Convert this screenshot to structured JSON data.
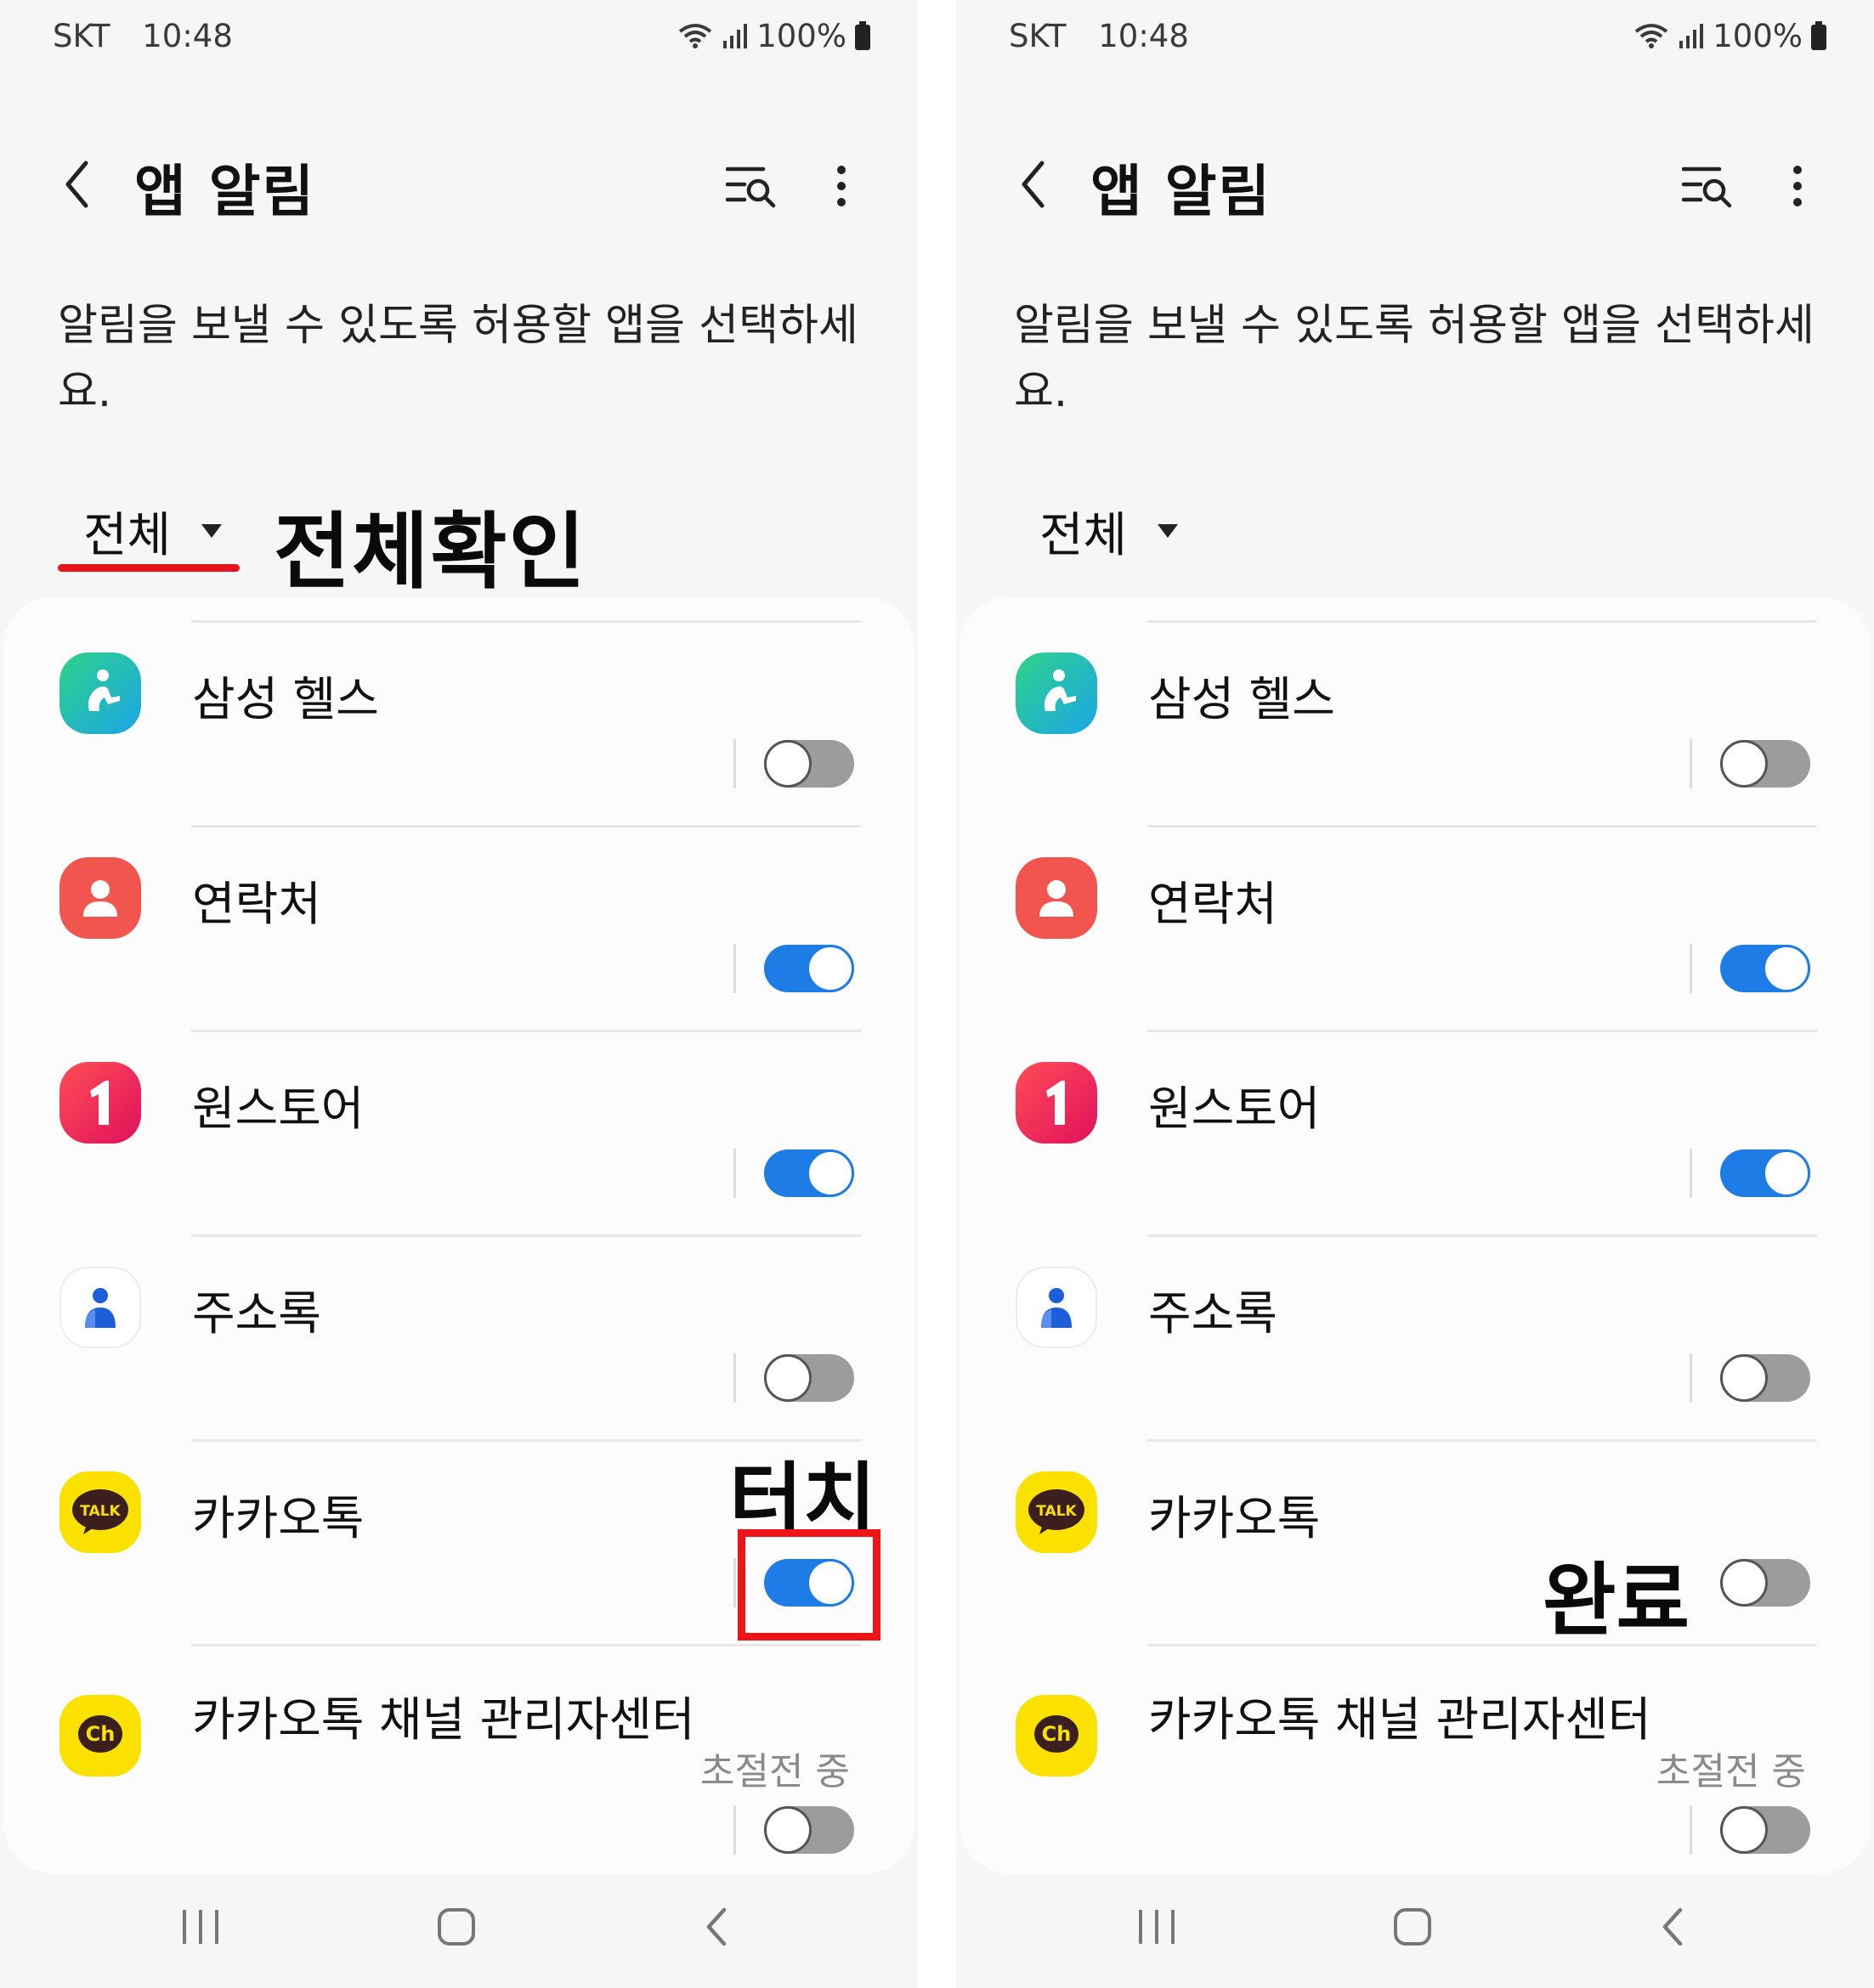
{
  "colors": {
    "accent": "#1d7ce5",
    "annotation_red": "#ee1418",
    "background": "#f6f6f6"
  },
  "screens": [
    {
      "status": {
        "carrier": "SKT",
        "time": "10:48",
        "battery": "100%"
      },
      "header": {
        "title": "앱 알림"
      },
      "description": "알림을 보낼 수 있도록 허용할 앱을 선택하세요.",
      "filter": {
        "label": "전체"
      },
      "annotation": "전체확인",
      "apps": [
        {
          "name": "삼성 헬스",
          "icon": "samsung-health-icon",
          "enabled": false
        },
        {
          "name": "연락처",
          "icon": "contacts-icon",
          "enabled": true
        },
        {
          "name": "원스토어",
          "icon": "onestore-icon",
          "enabled": true
        },
        {
          "name": "주소록",
          "icon": "address-book-icon",
          "enabled": false
        },
        {
          "name": "카카오톡",
          "icon": "kakaotalk-icon",
          "enabled": true,
          "annotation": "터치"
        },
        {
          "name": "카카오톡 채널 관리자센터",
          "icon": "kakao-channel-icon",
          "enabled": false,
          "sub": "초절전 중"
        }
      ]
    },
    {
      "status": {
        "carrier": "SKT",
        "time": "10:48",
        "battery": "100%"
      },
      "header": {
        "title": "앱 알림"
      },
      "description": "알림을 보낼 수 있도록 허용할 앱을 선택하세요.",
      "filter": {
        "label": "전체"
      },
      "apps": [
        {
          "name": "삼성 헬스",
          "icon": "samsung-health-icon",
          "enabled": false
        },
        {
          "name": "연락처",
          "icon": "contacts-icon",
          "enabled": true
        },
        {
          "name": "원스토어",
          "icon": "onestore-icon",
          "enabled": true
        },
        {
          "name": "주소록",
          "icon": "address-book-icon",
          "enabled": false
        },
        {
          "name": "카카오톡",
          "icon": "kakaotalk-icon",
          "enabled": false,
          "annotation": "완료"
        },
        {
          "name": "카카오톡 채널 관리자센터",
          "icon": "kakao-channel-icon",
          "enabled": false,
          "sub": "초절전 중"
        }
      ]
    }
  ]
}
